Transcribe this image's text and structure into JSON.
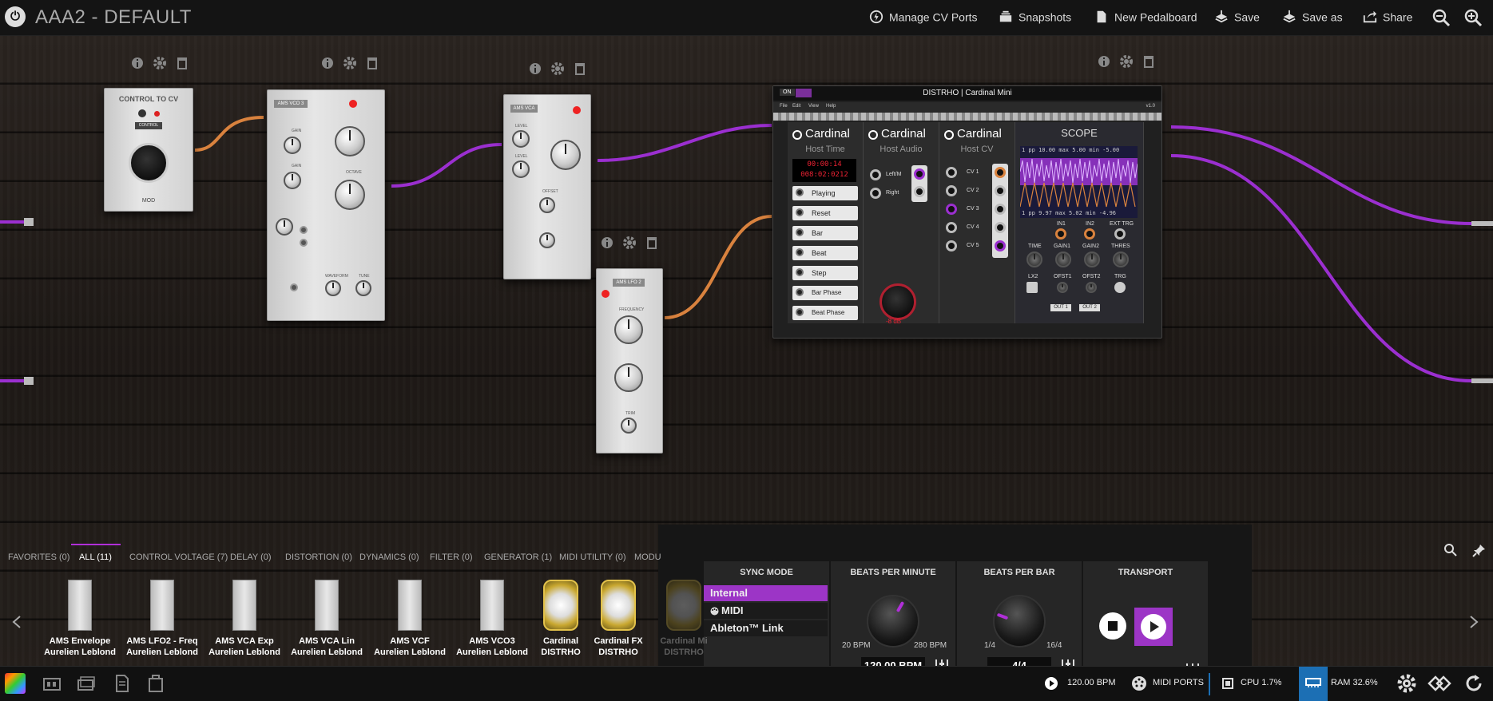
{
  "app": {
    "title": "AAA2 - DEFAULT",
    "accent": "#b02fd8",
    "cable_purple": "#9b2fd0",
    "cable_orange": "#d9823e"
  },
  "toolbar": {
    "manage_cv": "Manage CV Ports",
    "snapshots": "Snapshots",
    "new_pedalboard": "New Pedalboard",
    "save": "Save",
    "save_as": "Save as",
    "share": "Share"
  },
  "plugins": {
    "control_to_cv": {
      "title": "CONTROL TO CV",
      "sub": "CONTROL",
      "brand": "MOD"
    },
    "vco": {
      "label": "AMS VCO 3",
      "labels": [
        "GAIN",
        "GAIN",
        "OCTAVE",
        "WAVEFORM",
        "TUNE"
      ]
    },
    "vca": {
      "label": "AMS VCA",
      "labels": [
        "LEVEL",
        "LEVEL",
        "OFFSET"
      ]
    },
    "lfo": {
      "label": "AMS LFO 2",
      "labels": [
        "FREQUENCY",
        "TRIM"
      ]
    }
  },
  "cardinal": {
    "on": "ON",
    "title": "DISTRHO | Cardinal Mini",
    "menu": [
      "File",
      "Edit",
      "View",
      "Help"
    ],
    "version": "v1.0",
    "modules": [
      {
        "name": "Cardinal",
        "sub": "Host Time"
      },
      {
        "name": "Cardinal",
        "sub": "Host Audio"
      },
      {
        "name": "Cardinal",
        "sub": "Host CV"
      }
    ],
    "clock_time": "00:00:14",
    "clock_bbt": "008:02:0212",
    "time_buttons": [
      "Playing",
      "Reset",
      "Bar",
      "Beat",
      "Step",
      "Bar Phase",
      "Beat Phase"
    ],
    "audio_ports": [
      "Left/M",
      "Right"
    ],
    "cv_ports": [
      "CV 1",
      "CV 2",
      "CV 3",
      "CV 4",
      "CV 5"
    ],
    "gain_label": "-8 dB",
    "scope": {
      "title": "SCOPE",
      "readout_top": "1 pp 10.00 max 5.00 min -5.00",
      "readout_bottom": "1 pp 9.97 max 5.02 min -4.96",
      "inputs": [
        "IN1",
        "IN2",
        "EXT TRG"
      ],
      "controls": [
        "TIME",
        "GAIN1",
        "GAIN2",
        "THRES"
      ],
      "controls2": [
        "LX2",
        "OFST1",
        "OFST2",
        "TRG"
      ],
      "outs": [
        "OUT 1",
        "OUT 2"
      ]
    }
  },
  "sync": {
    "mode_header": "SYNC MODE",
    "modes": [
      "Internal",
      "MIDI",
      "Ableton™ Link"
    ],
    "selected": "Internal",
    "bpm_header": "BEATS PER MINUTE",
    "bpm_min": "20 BPM",
    "bpm_max": "280 BPM",
    "bpm_value": "120.00 BPM",
    "bpb_header": "BEATS PER BAR",
    "bpb_min": "1/4",
    "bpb_max": "16/4",
    "bpb_value": "4/4",
    "transport_header": "TRANSPORT"
  },
  "categories": [
    "FAVORITES (0)",
    "ALL (11)",
    "CONTROL VOLTAGE (7)",
    "DELAY (0)",
    "DISTORTION (0)",
    "DYNAMICS (0)",
    "FILTER (0)",
    "GENERATOR (1)",
    "MIDI UTILITY (0)",
    "MODU"
  ],
  "selected_category": "ALL (11)",
  "plugin_list": [
    {
      "name": "AMS Envelope",
      "author": "Aurelien Leblond"
    },
    {
      "name": "AMS LFO2 - Freq",
      "author": "Aurelien Leblond"
    },
    {
      "name": "AMS VCA Exp",
      "author": "Aurelien Leblond"
    },
    {
      "name": "AMS VCA Lin",
      "author": "Aurelien Leblond"
    },
    {
      "name": "AMS VCF",
      "author": "Aurelien Leblond"
    },
    {
      "name": "AMS VCO3",
      "author": "Aurelien Leblond"
    },
    {
      "name": "Cardinal",
      "author": "DISTRHO"
    },
    {
      "name": "Cardinal FX",
      "author": "DISTRHO"
    },
    {
      "name": "Cardinal Mi",
      "author": "DISTRHO"
    }
  ],
  "status": {
    "bpm": "120.00 BPM",
    "midi_ports": "MIDI PORTS",
    "cpu": "CPU 1.7%",
    "ram": "RAM 32.6%"
  }
}
